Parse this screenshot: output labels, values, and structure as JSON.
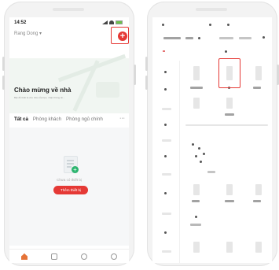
{
  "status": {
    "time": "14:52"
  },
  "home": {
    "name": "Rang Dong",
    "chevron": "▾",
    "add_icon": "plus-circle-icon"
  },
  "welcome": {
    "title": "Chào mừng về nhà",
    "subtitle": "Bật đủ thiết bị cho nhà của bạn, nhận thông tin..."
  },
  "tabs": [
    {
      "label": "Tất cả",
      "active": true
    },
    {
      "label": "Phòng khách",
      "active": false
    },
    {
      "label": "Phòng ngủ chính",
      "active": false
    }
  ],
  "tabs_more": "···",
  "empty_state": {
    "message": "Chưa có thiết bị",
    "button_label": "Thêm thiết bị"
  },
  "bottom_nav": [
    {
      "icon": "home-icon",
      "active": true
    },
    {
      "icon": "scene-icon",
      "active": false
    },
    {
      "icon": "smart-icon",
      "active": false
    },
    {
      "icon": "profile-icon",
      "active": false
    }
  ],
  "colors": {
    "accent_red": "#e53935",
    "home_orange": "#e57338",
    "success_green": "#2bb46e"
  }
}
